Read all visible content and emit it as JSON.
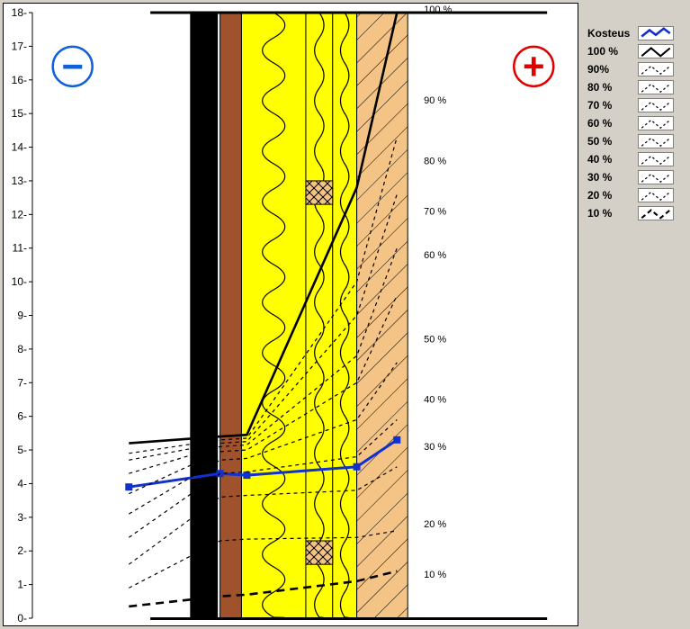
{
  "chart_data": {
    "type": "line",
    "title": "",
    "xlabel": "",
    "ylabel": "",
    "ylim": [
      0,
      18
    ],
    "yticks": [
      0,
      1,
      2,
      3,
      4,
      5,
      6,
      7,
      8,
      9,
      10,
      11,
      12,
      13,
      14,
      15,
      16,
      17,
      18
    ],
    "pct_labels": [
      "100 %",
      "90 %",
      "80 %",
      "70 %",
      "60 %",
      "50 %",
      "40 %",
      "30 %",
      "20 %",
      "10 %"
    ],
    "pct_label_y": [
      18,
      15.3,
      13.5,
      12,
      10.7,
      8.2,
      6.4,
      5.0,
      2.7,
      1.2
    ],
    "x_positions": [
      0.18,
      0.35,
      0.4,
      0.605,
      0.68
    ],
    "series": [
      {
        "name": "Kosteus",
        "style": "kosteus",
        "values": [
          3.9,
          4.3,
          4.25,
          4.5,
          5.3
        ]
      },
      {
        "name": "100 %",
        "style": "solid",
        "values": [
          5.2,
          5.4,
          5.45,
          12.8,
          18
        ]
      },
      {
        "name": "90 %",
        "style": "dash",
        "values": [
          4.9,
          5.3,
          5.35,
          10.0,
          14.3
        ]
      },
      {
        "name": "80 %",
        "style": "dash",
        "values": [
          4.7,
          5.2,
          5.25,
          9.0,
          12.6
        ]
      },
      {
        "name": "70 %",
        "style": "dash",
        "values": [
          4.3,
          5.1,
          5.15,
          7.8,
          11.0
        ]
      },
      {
        "name": "60 %",
        "style": "dash",
        "values": [
          3.7,
          4.95,
          5.0,
          7.0,
          9.6
        ]
      },
      {
        "name": "50 %",
        "style": "dash",
        "values": [
          3.1,
          4.7,
          4.75,
          5.9,
          7.6
        ]
      },
      {
        "name": "40 %",
        "style": "dash",
        "values": [
          2.4,
          4.3,
          4.35,
          4.8,
          5.9
        ]
      },
      {
        "name": "30 %",
        "style": "dash",
        "values": [
          1.6,
          3.6,
          3.65,
          3.8,
          4.5
        ]
      },
      {
        "name": "20 %",
        "style": "dash",
        "values": [
          0.9,
          2.3,
          2.35,
          2.4,
          2.6
        ]
      },
      {
        "name": "10 %",
        "style": "thickdash",
        "values": [
          0.35,
          0.65,
          0.7,
          1.1,
          1.4
        ]
      }
    ],
    "layers": [
      {
        "x0": 0.295,
        "x1": 0.345,
        "fill": "#000000",
        "pattern": "none"
      },
      {
        "x0": 0.35,
        "x1": 0.39,
        "fill": "#a0522d",
        "pattern": "none"
      },
      {
        "x0": 0.39,
        "x1": 0.51,
        "fill": "#ffff00",
        "pattern": "wave"
      },
      {
        "x0": 0.51,
        "x1": 0.56,
        "fill": "#ffff00",
        "pattern": "wave"
      },
      {
        "x0": 0.56,
        "x1": 0.605,
        "fill": "#ffff00",
        "pattern": "wave"
      },
      {
        "x0": 0.605,
        "x1": 0.7,
        "fill": "#f4c487",
        "pattern": "hatch"
      }
    ],
    "crossboxes": [
      {
        "layer": 3,
        "y0": 12.3,
        "y1": 13.0
      },
      {
        "layer": 3,
        "y0": 1.6,
        "y1": 2.3
      }
    ]
  },
  "legend": {
    "items": [
      {
        "label": "Kosteus",
        "style": "kosteus"
      },
      {
        "label": "100 %",
        "style": "solid"
      },
      {
        "label": "90%",
        "style": "dash"
      },
      {
        "label": "80 %",
        "style": "dash"
      },
      {
        "label": "70 %",
        "style": "dash"
      },
      {
        "label": "60 %",
        "style": "dash"
      },
      {
        "label": "50 %",
        "style": "dash"
      },
      {
        "label": "40 %",
        "style": "dash"
      },
      {
        "label": "30 %",
        "style": "dash"
      },
      {
        "label": "20 %",
        "style": "dash"
      },
      {
        "label": "10 %",
        "style": "thickdash"
      }
    ]
  },
  "symbols": {
    "minus": "−",
    "plus": "+"
  }
}
